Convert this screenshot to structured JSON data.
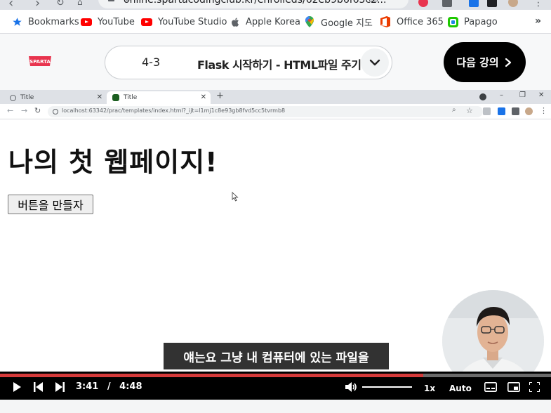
{
  "outer_browser": {
    "url": "online.spartacodingclub.kr/enrolleds/62eb9b6f65c2..."
  },
  "bookmarks": [
    {
      "label": "Bookmarks",
      "icon": "star-icon"
    },
    {
      "label": "YouTube",
      "icon": "youtube-icon"
    },
    {
      "label": "YouTube Studio",
      "icon": "youtube-icon"
    },
    {
      "label": "Apple Korea",
      "icon": "apple-icon"
    },
    {
      "label": "Google 지도",
      "icon": "google-maps-icon"
    },
    {
      "label": "Office 365",
      "icon": "office-icon"
    },
    {
      "label": "Papago",
      "icon": "papago-icon"
    }
  ],
  "bookmarks_more": "»",
  "course_header": {
    "logo_text": "SPARTA",
    "lesson_number": "4-3",
    "lesson_title": "Flask 시작하기 - HTML파일 주기",
    "next_button": "다음 강의"
  },
  "inner_browser": {
    "tabs": [
      {
        "title": "Title"
      },
      {
        "title": "Title"
      }
    ],
    "url": "localhost:63342/prac/templates/index.html?_ijt=l1mj1c8e93gb8fvd5cc5tvrmb8"
  },
  "page": {
    "heading": "나의 첫 웹페이지!",
    "button_label": "버튼을 만들자"
  },
  "subtitle": "얘는요 그냥 내 컴퓨터에 있는 파일을",
  "player": {
    "current_time": "3:41",
    "separator": "/",
    "duration": "4:48",
    "progress_fraction": 0.768,
    "volume_fraction": 1.0,
    "speed": "1x",
    "quality": "Auto"
  },
  "colors": {
    "progress": "#d53a3a",
    "sparta_brand": "#e8344e",
    "next_button_bg": "#000000"
  }
}
